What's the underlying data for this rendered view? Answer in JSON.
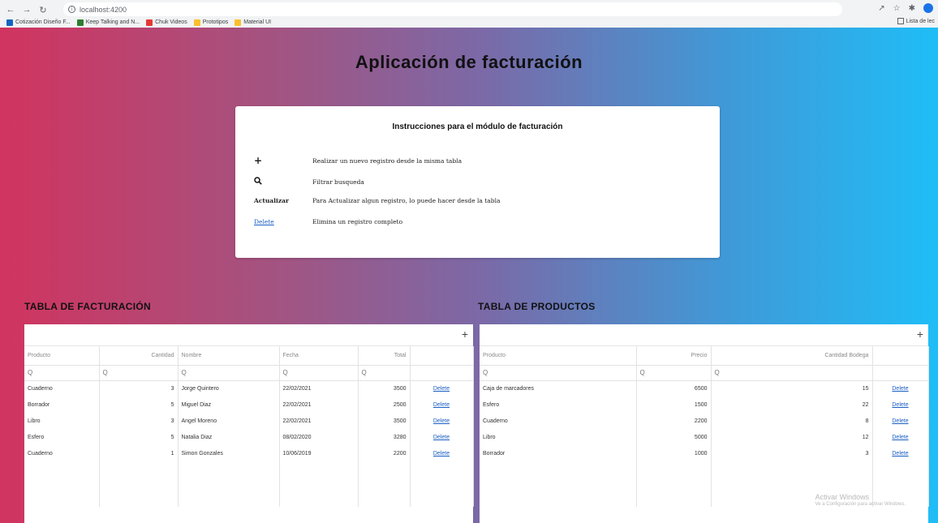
{
  "browser": {
    "url": "localhost:4200",
    "bookmarks": [
      {
        "label": "Cotización Diseño F...",
        "color": "#1565c0"
      },
      {
        "label": "Keep Talking and N...",
        "color": "#2e7d32"
      },
      {
        "label": "Chuk Videos",
        "color": "#e53935"
      },
      {
        "label": "Prototipos",
        "color": "#fbc02d"
      },
      {
        "label": "Material UI",
        "color": "#fbc02d"
      }
    ],
    "reading_list": "Lista de lec"
  },
  "app": {
    "title": "Aplicación de facturación",
    "instructions": {
      "title": "Instrucciones para el módulo de facturación",
      "items": [
        {
          "key": "+",
          "text": "Realizar un nuevo registro desde la misma tabla"
        },
        {
          "key": "search-icon",
          "text": "Filtrar busqueda"
        },
        {
          "key": "Actualizar",
          "text": "Para Actualizar algun registro, lo puede hacer desde la tabla"
        },
        {
          "key": "Delete",
          "text": "Elimina un registro completo"
        }
      ]
    },
    "billing": {
      "section_title": "TABLA DE FACTURACIÓN",
      "add_label": "+",
      "columns": [
        "Producto",
        "Cantidad",
        "Nombre",
        "Fecha",
        "Total",
        ""
      ],
      "filter_placeholder": "Q",
      "rows": [
        {
          "producto": "Cuaderno",
          "cantidad": "3",
          "nombre": "Jorge Quintero",
          "fecha": "22/02/2021",
          "total": "3500",
          "action": "Delete"
        },
        {
          "producto": "Borrador",
          "cantidad": "5",
          "nombre": "Miguel Diaz",
          "fecha": "22/02/2021",
          "total": "2500",
          "action": "Delete"
        },
        {
          "producto": "Libro",
          "cantidad": "3",
          "nombre": "Angel Moreno",
          "fecha": "22/02/2021",
          "total": "3500",
          "action": "Delete"
        },
        {
          "producto": "Esfero",
          "cantidad": "5",
          "nombre": "Natalia Diaz",
          "fecha": "08/02/2020",
          "total": "3280",
          "action": "Delete"
        },
        {
          "producto": "Cuaderno",
          "cantidad": "1",
          "nombre": "Simon Gonzales",
          "fecha": "10/06/2019",
          "total": "2200",
          "action": "Delete"
        }
      ]
    },
    "products": {
      "section_title": "TABLA DE PRODUCTOS",
      "add_label": "+",
      "columns": [
        "Producto",
        "Precio",
        "Cantidad Bodega",
        ""
      ],
      "filter_placeholder": "Q",
      "rows": [
        {
          "producto": "Caja de marcadores",
          "precio": "6500",
          "cantidad": "15",
          "action": "Delete"
        },
        {
          "producto": "Esfero",
          "precio": "1500",
          "cantidad": "22",
          "action": "Delete"
        },
        {
          "producto": "Cuaderno",
          "precio": "2200",
          "cantidad": "8",
          "action": "Delete"
        },
        {
          "producto": "Libro",
          "precio": "5000",
          "cantidad": "12",
          "action": "Delete"
        },
        {
          "producto": "Borrador",
          "precio": "1000",
          "cantidad": "3",
          "action": "Delete"
        }
      ]
    },
    "watermark": {
      "title": "Activar Windows",
      "subtitle": "Ve a Configuración para activar Windows."
    }
  }
}
